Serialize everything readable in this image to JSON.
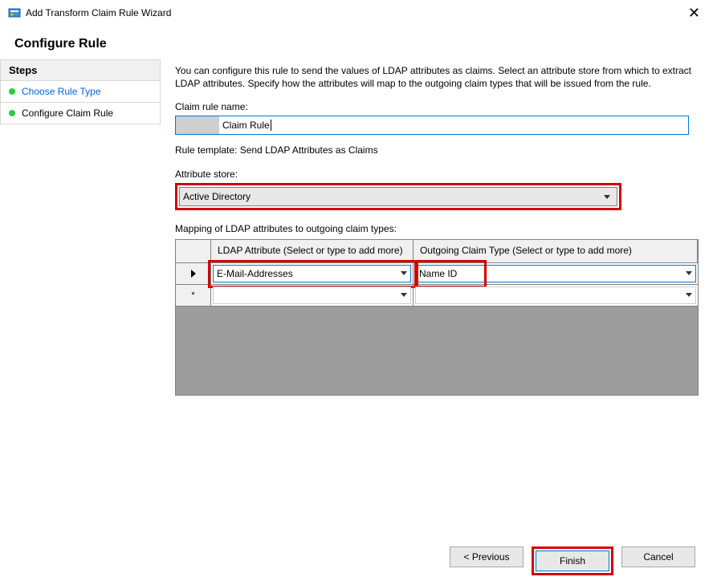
{
  "titlebar": {
    "title": "Add Transform Claim Rule Wizard"
  },
  "heading": "Configure Rule",
  "sidebar": {
    "header": "Steps",
    "items": [
      {
        "label": "Choose Rule Type"
      },
      {
        "label": "Configure Claim Rule"
      }
    ]
  },
  "main": {
    "intro": "You can configure this rule to send the values of LDAP attributes as claims. Select an attribute store from which to extract LDAP attributes. Specify how the attributes will map to the outgoing claim types that will be issued from the rule.",
    "rule_name_label": "Claim rule name:",
    "rule_name_value": "Claim Rule",
    "template_text": "Rule template: Send LDAP Attributes as Claims",
    "attr_store_label": "Attribute store:",
    "attr_store_value": "Active Directory",
    "mapping_label": "Mapping of LDAP attributes to outgoing claim types:",
    "table": {
      "head_left": "LDAP Attribute (Select or type to add more)",
      "head_right": "Outgoing Claim Type (Select or type to add more)",
      "rows": [
        {
          "ldap": "E-Mail-Addresses",
          "claim": "Name ID"
        },
        {
          "ldap": "",
          "claim": ""
        }
      ]
    }
  },
  "footer": {
    "previous": "< Previous",
    "finish": "Finish",
    "cancel": "Cancel"
  }
}
